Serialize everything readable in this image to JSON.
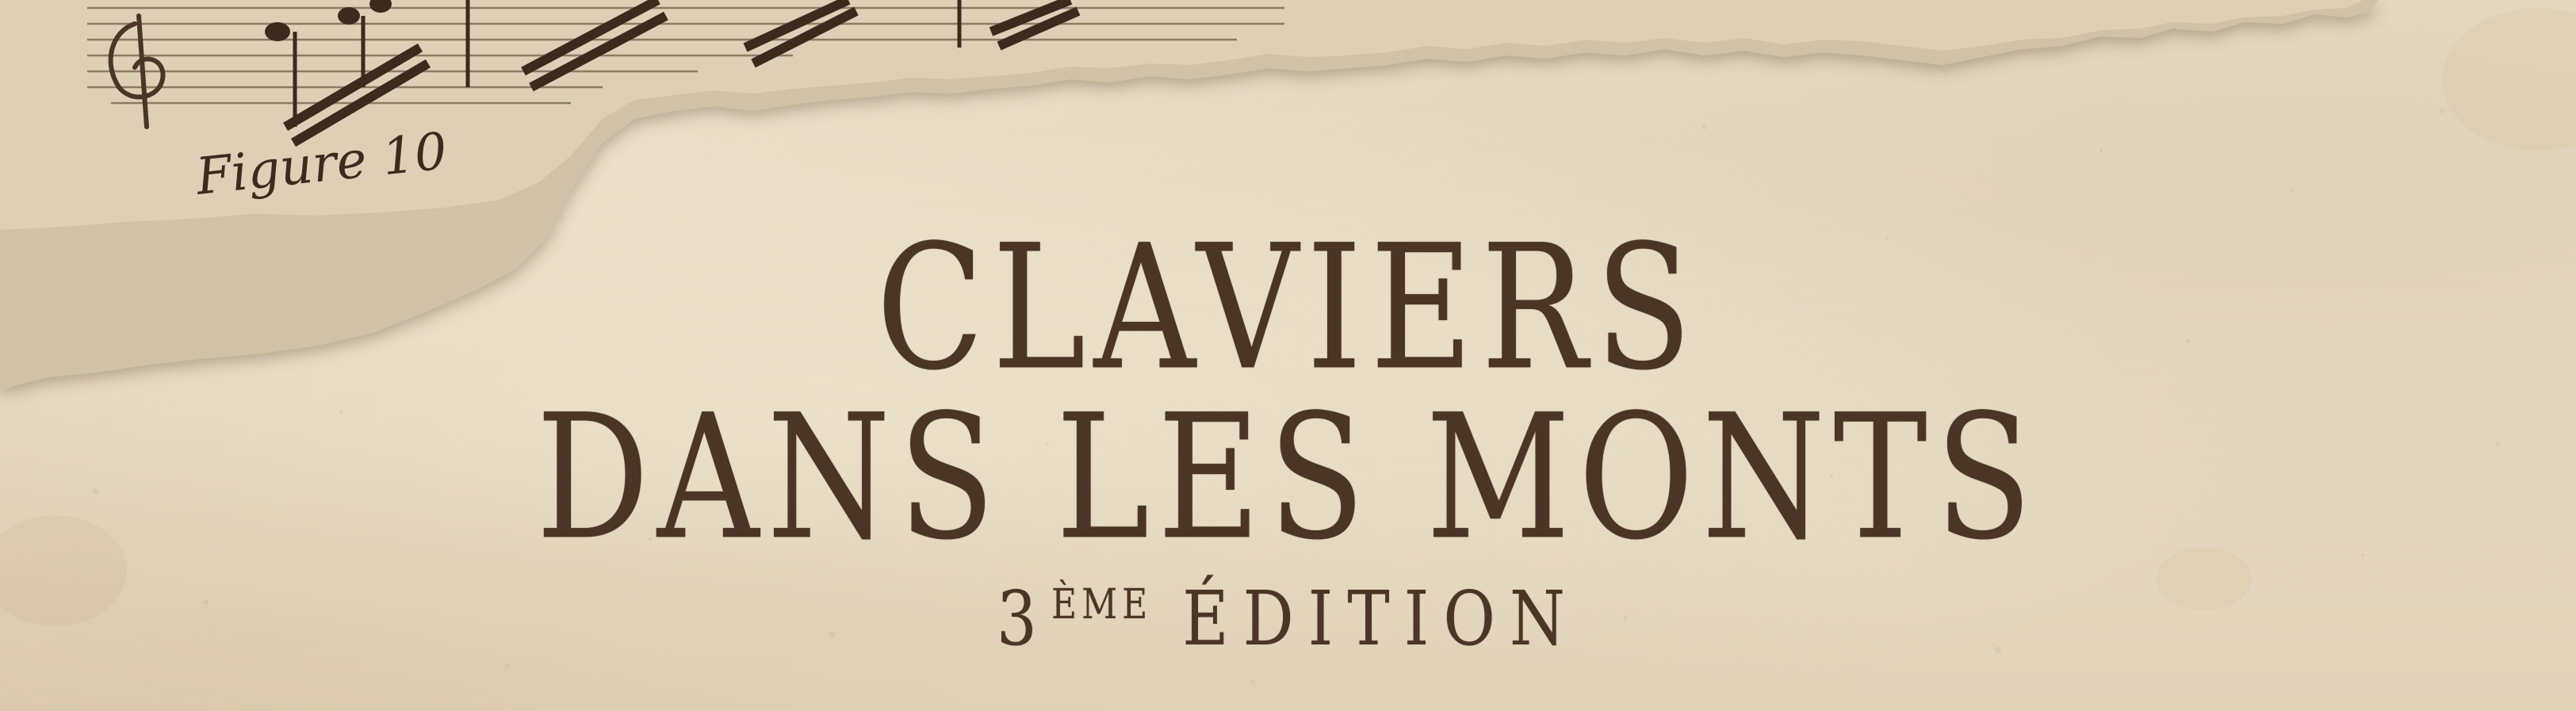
{
  "title": {
    "line1": "CLAVIERS",
    "line2": "DANS LES MONTS"
  },
  "edition": {
    "number": "3",
    "suffix": "ÈME",
    "word": "ÉDITION"
  },
  "sheet_music": {
    "caption": "Figure 10"
  },
  "colors": {
    "paper": "#e7dcc6",
    "ink": "#4a3527",
    "torn_edge": "#cfc2a8"
  }
}
